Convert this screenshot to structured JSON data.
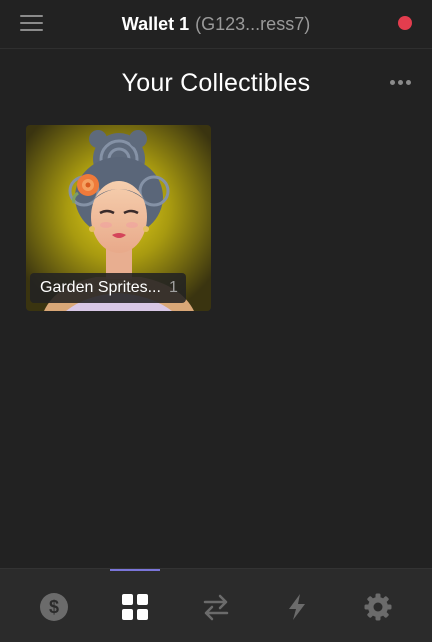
{
  "header": {
    "menu_icon": "hamburger-menu-icon",
    "wallet_name": "Wallet 1",
    "wallet_address": "(G123...ress7)",
    "status_color": "#e33d4e"
  },
  "main": {
    "title": "Your Collectibles",
    "more_icon": "more-horizontal-icon"
  },
  "collectibles": [
    {
      "name": "Garden Sprites...",
      "count": "1"
    }
  ],
  "tabbar": {
    "active_tab": "collectibles",
    "accent_color": "#7a75d9",
    "tabs": [
      {
        "id": "balances",
        "icon": "dollar-circle-icon"
      },
      {
        "id": "collectibles",
        "icon": "grid-icon"
      },
      {
        "id": "swap",
        "icon": "swap-arrows-icon"
      },
      {
        "id": "activity",
        "icon": "lightning-bolt-icon"
      },
      {
        "id": "settings",
        "icon": "gear-icon"
      }
    ]
  }
}
